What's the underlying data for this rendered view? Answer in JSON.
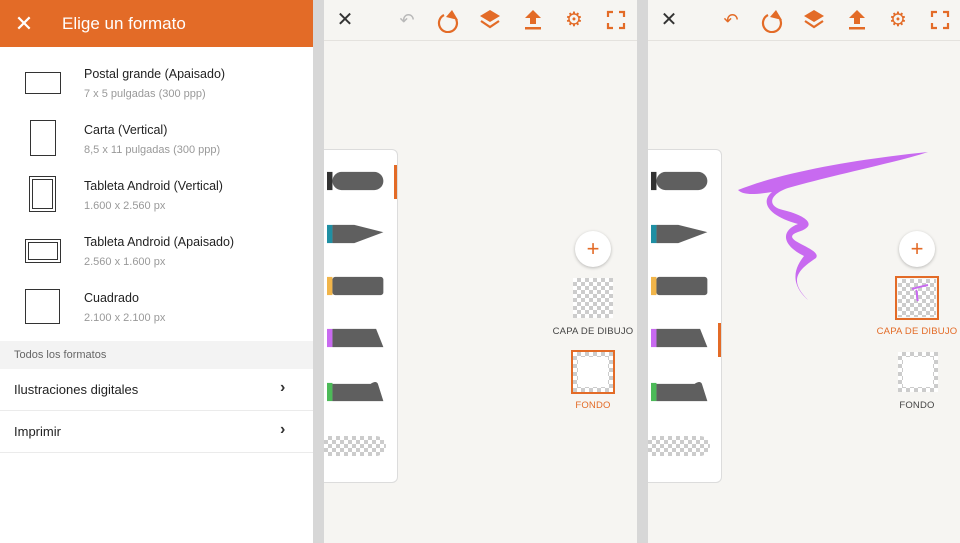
{
  "format_panel": {
    "title": "Elige un formato",
    "close_icon": "close-icon",
    "formats": [
      {
        "name": "Postal grande (Apaisado)",
        "size": "7 x 5 pulgadas (300 ppp)",
        "icon": "landscape-page-icon"
      },
      {
        "name": "Carta (Vertical)",
        "size": "8,5 x 11 pulgadas (300 ppp)",
        "icon": "portrait-page-icon"
      },
      {
        "name": "Tableta Android (Vertical)",
        "size": "1.600 x 2.560 px",
        "icon": "tablet-portrait-icon"
      },
      {
        "name": "Tableta Android (Apaisado)",
        "size": "2.560 x 1.600 px",
        "icon": "tablet-landscape-icon"
      },
      {
        "name": "Cuadrado",
        "size": "2.100 x 2.100 px",
        "icon": "square-icon"
      }
    ],
    "section_label": "Todos los formatos",
    "categories": [
      {
        "label": "Ilustraciones digitales"
      },
      {
        "label": "Imprimir"
      }
    ]
  },
  "toolbar": {
    "icons": [
      "close-icon",
      "undo-icon",
      "shapes-icon",
      "layers-icon",
      "share-icon",
      "settings-icon",
      "fullscreen-icon"
    ]
  },
  "layers": {
    "drawing_layer_label": "CAPA DE DIBUJO",
    "background_label": "FONDO"
  },
  "brushes": [
    {
      "name": "pencil",
      "tip_color": "#333333"
    },
    {
      "name": "ink",
      "tip_color": "#1f8fa3"
    },
    {
      "name": "marker",
      "tip_color": "#f1b54a"
    },
    {
      "name": "paint",
      "tip_color": "#c86af0"
    },
    {
      "name": "watercolor",
      "tip_color": "#4cba58"
    },
    {
      "name": "eraser",
      "tip_color": "#cccccc"
    }
  ],
  "colors": {
    "accent": "#e36b27",
    "stroke": "#c86af0"
  }
}
